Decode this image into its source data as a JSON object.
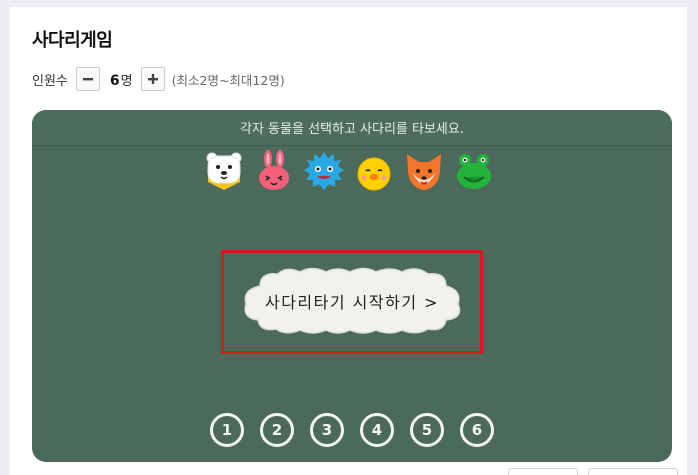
{
  "page": {
    "title": "사다리게임"
  },
  "people": {
    "label": "인원수",
    "value": "6",
    "unit": "명",
    "hint": "(최소2명~최대12명)",
    "minus_icon": "minus-icon",
    "plus_icon": "plus-icon"
  },
  "board": {
    "instruction": "각자 동물을 선택하고 사다리를 타보세요.",
    "animals": [
      {
        "name": "polar-bear-icon",
        "color": "#ffffff"
      },
      {
        "name": "rabbit-icon",
        "color": "#f4607a"
      },
      {
        "name": "hedgehog-icon",
        "color": "#2aa9e6"
      },
      {
        "name": "chick-icon",
        "color": "#ffd000"
      },
      {
        "name": "fox-icon",
        "color": "#f3752b"
      },
      {
        "name": "frog-icon",
        "color": "#24b33a"
      }
    ],
    "start_button_label": "사다리타기 시작하기 >",
    "numbers": [
      "1",
      "2",
      "3",
      "4",
      "5",
      "6"
    ],
    "board_color": "#4b6a5b",
    "highlight_color": "#d7191c"
  }
}
